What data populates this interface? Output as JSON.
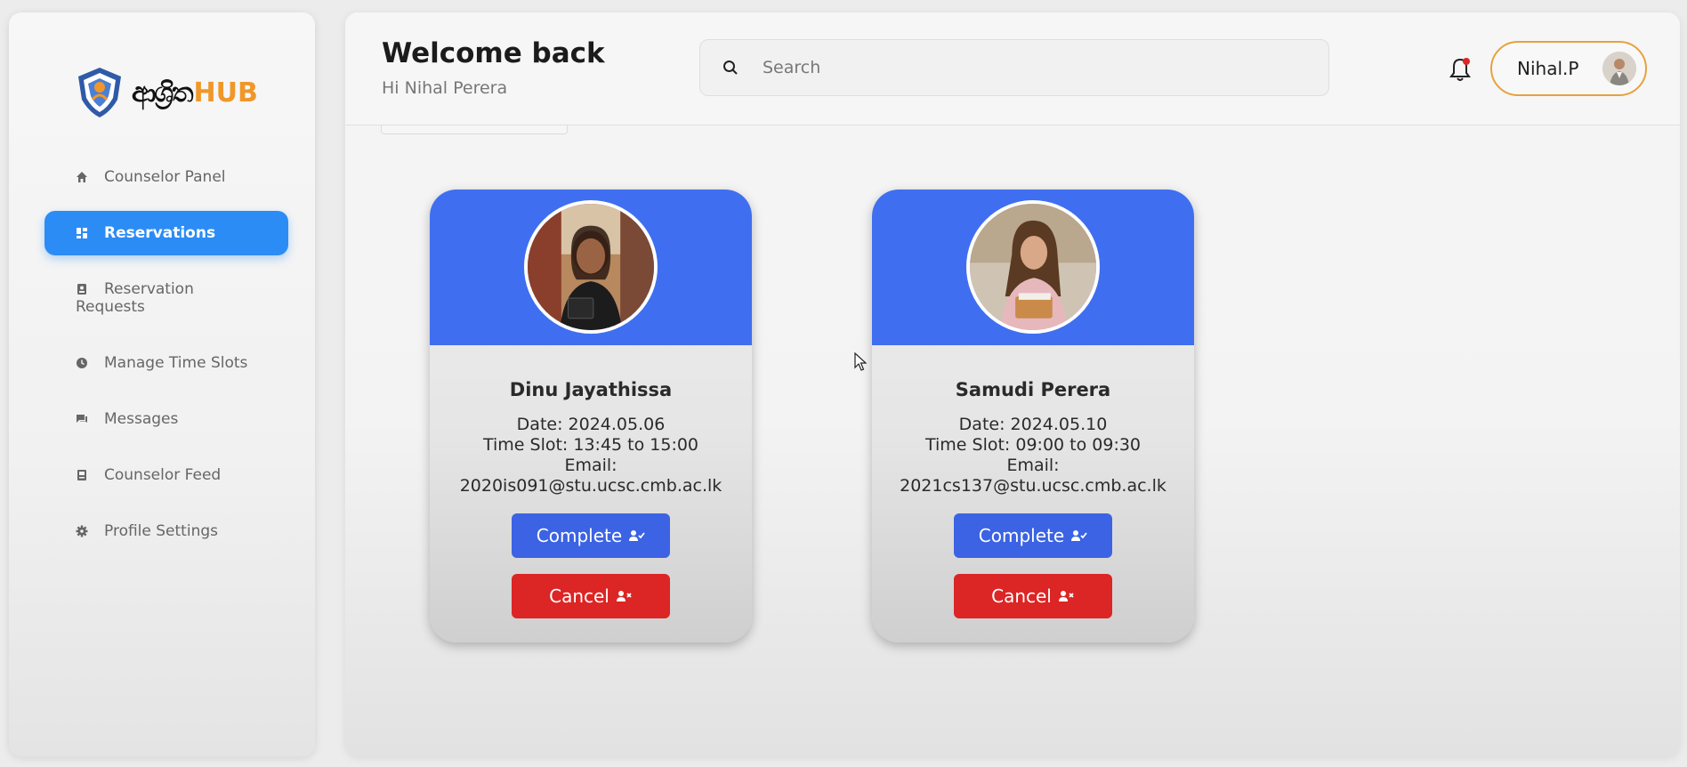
{
  "app": {
    "logo_script": "ආශ්‍රිත",
    "logo_hub": "HUB",
    "brand_color": "#f0972a"
  },
  "sidebar": {
    "items": [
      {
        "label": "Counselor Panel",
        "icon": "home-icon",
        "active": false
      },
      {
        "label": "Reservations",
        "icon": "dashboard-icon",
        "active": true
      },
      {
        "label": "Reservation Requests",
        "icon": "id-badge-icon",
        "active": false
      },
      {
        "label": "Manage Time Slots",
        "icon": "clock-icon",
        "active": false
      },
      {
        "label": "Messages",
        "icon": "chat-icon",
        "active": false
      },
      {
        "label": "Counselor Feed",
        "icon": "feed-icon",
        "active": false
      },
      {
        "label": "Profile Settings",
        "icon": "gear-icon",
        "active": false
      }
    ],
    "active_color": "#2c8cf5"
  },
  "header": {
    "title": "Welcome back",
    "subtitle": "Hi Nihal Perera",
    "search_placeholder": "Search",
    "user_name": "Nihal.P",
    "notification_dot": true
  },
  "reservations": [
    {
      "name": "Dinu Jayathissa",
      "date_line": "Date: 2024.05.06",
      "time_line": "Time Slot: 13:45 to 15:00",
      "email_label": "Email:",
      "email": "2020is091@stu.ucsc.cmb.ac.lk",
      "complete_label": "Complete",
      "cancel_label": "Cancel"
    },
    {
      "name": "Samudi Perera",
      "date_line": "Date: 2024.05.10",
      "time_line": "Time Slot: 09:00 to 09:30",
      "email_label": "Email:",
      "email": "2021cs137@stu.ucsc.cmb.ac.lk",
      "complete_label": "Complete",
      "cancel_label": "Cancel"
    }
  ],
  "colors": {
    "card_header": "#3f6ff0",
    "complete_button": "#3b63e3",
    "cancel_button": "#dc2525",
    "user_chip_border": "#e6a23c"
  }
}
